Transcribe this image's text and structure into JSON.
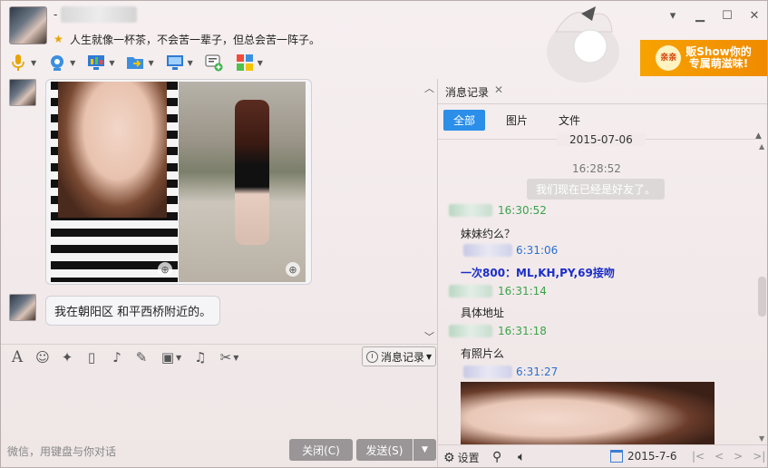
{
  "window": {
    "contact_prefix": "-",
    "signature": "人生就像一杯茶，不会苦一辈子，但总会苦一阵子。",
    "controls": {
      "dropdown": "▾",
      "minimize": "▁",
      "maximize": "☐",
      "close": "✕"
    }
  },
  "ad": {
    "logo": "亲亲",
    "line1": "贩Show你的",
    "line2": "专属萌滋味!"
  },
  "chat": {
    "messages": [
      {
        "type": "images",
        "count": 2
      },
      {
        "type": "text",
        "text": "我在朝阳区 和平西桥附近的。"
      }
    ]
  },
  "edit_toolbar": {
    "history_button": "消息记录",
    "placeholder": "微信，用键盘与你对话",
    "close_button": "关闭(C)",
    "send_button": "发送(S)"
  },
  "history": {
    "tab_title": "消息记录",
    "filters": [
      "全部",
      "图片",
      "文件"
    ],
    "active_filter": "全部",
    "date": "2015-07-06",
    "system_time": "16:28:52",
    "system_message": "我们现在已经是好友了。",
    "entries": [
      {
        "who": "them",
        "time": "16:30:52",
        "text": "妹妹约么？"
      },
      {
        "who": "me",
        "time": "6:31:06",
        "text": "一次800：ML,KH,PY,69接吻"
      },
      {
        "who": "them",
        "time": "16:31:14",
        "text": "具体地址"
      },
      {
        "who": "them",
        "time": "16:31:18",
        "text": "有照片么"
      },
      {
        "who": "me",
        "time": "6:31:27",
        "text": ""
      }
    ],
    "bottom": {
      "settings": "设置",
      "date": "2015-7-6"
    }
  },
  "colors": {
    "accent_blue": "#2b8ee8",
    "them_time": "#3aa34a",
    "me_time": "#2b6fd0",
    "me_text": "#1b2ec9"
  }
}
